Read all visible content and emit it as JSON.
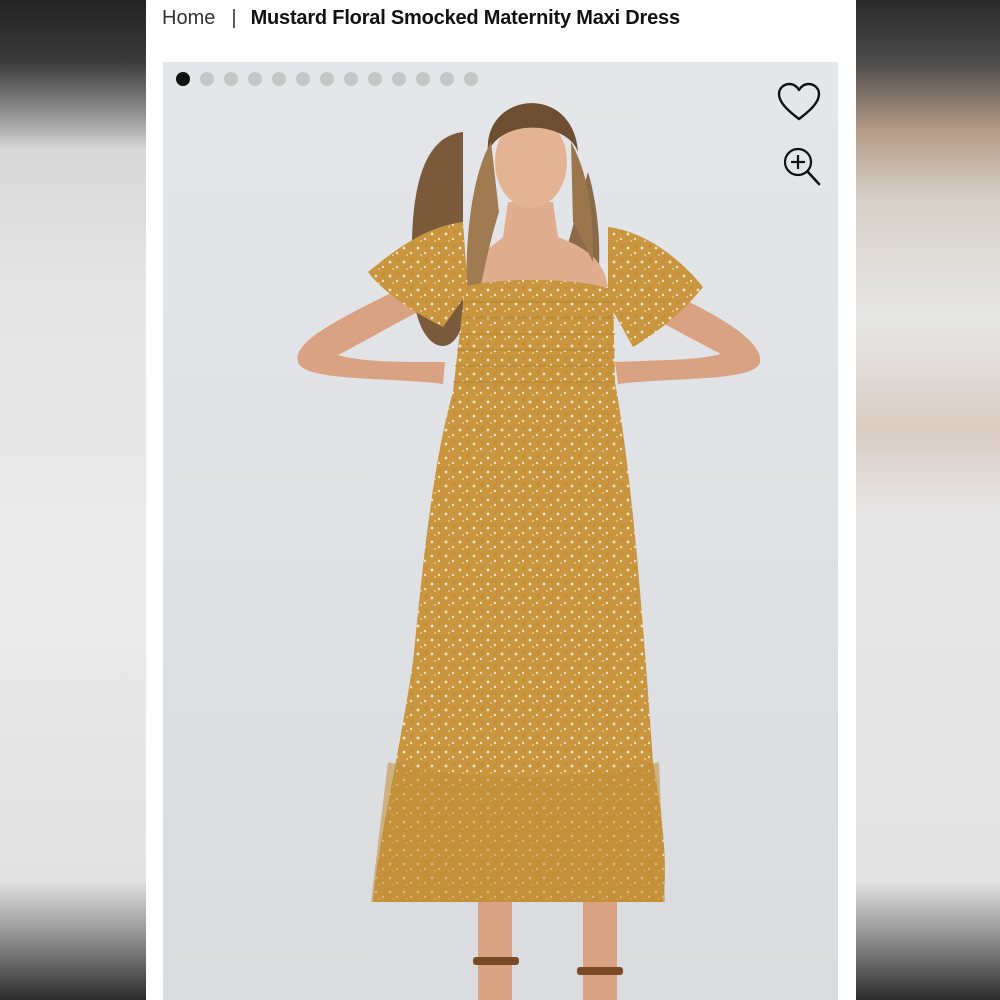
{
  "breadcrumb": {
    "home": "Home",
    "separator": "|",
    "current": "Mustard Floral Smocked Maternity Maxi Dress"
  },
  "gallery": {
    "slide_count": 13,
    "active_slide": 1,
    "image_alt": "Model wearing mustard floral smocked maternity maxi dress"
  },
  "icons": {
    "favorite": "heart-icon",
    "zoom": "zoom-in-icon"
  },
  "colors": {
    "dress": "#c9963f",
    "active_dot": "#111111",
    "inactive_dot": "#c6c6c6"
  }
}
